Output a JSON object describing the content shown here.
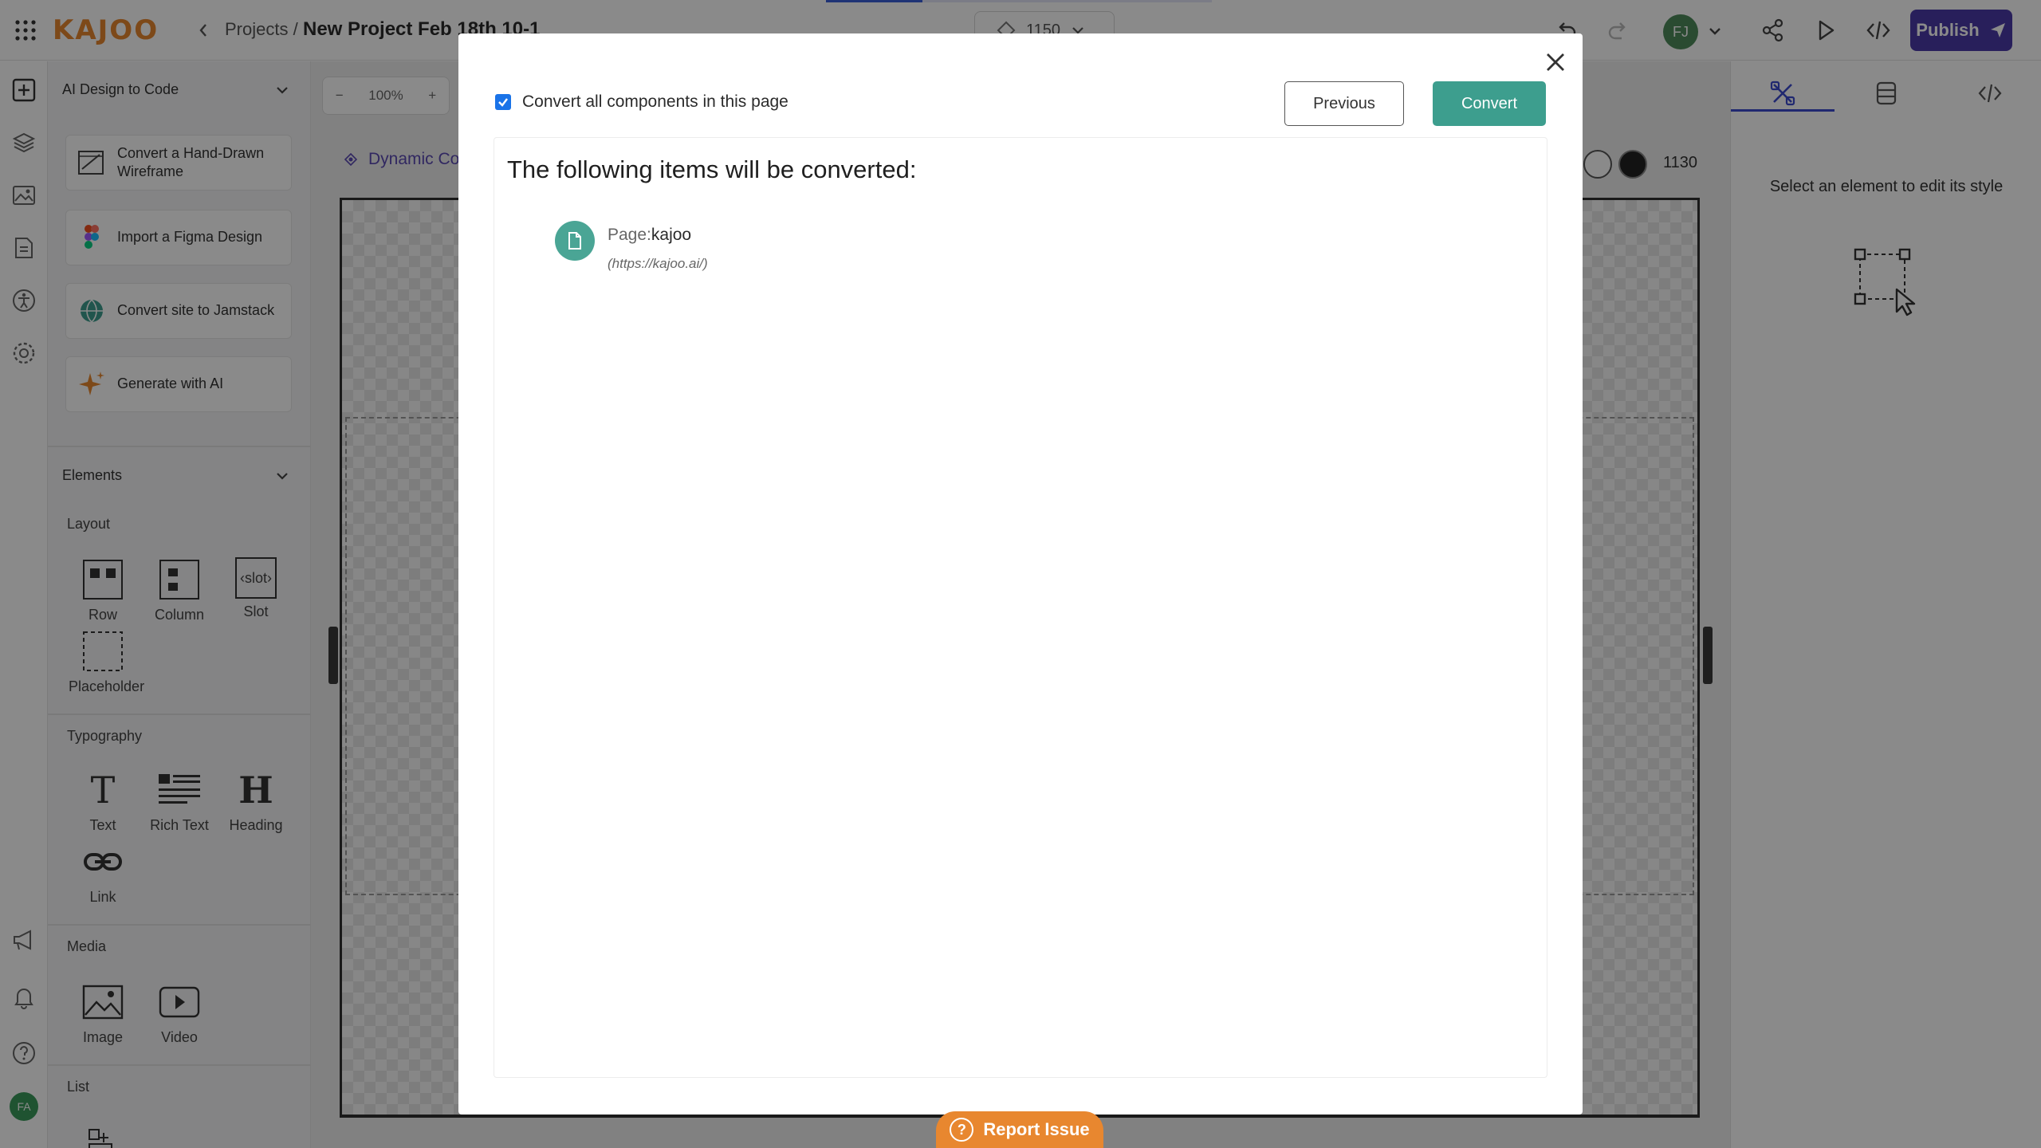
{
  "topbar": {
    "logo": "KAJOO",
    "breadcrumb_projects": "Projects /",
    "project_title": "New Project Feb 18th 10-1",
    "breakpoint_value": "1150",
    "avatar_initials": "FJ",
    "publish_label": "Publish",
    "loading_progress": 0.25
  },
  "left_panel": {
    "ai_section": {
      "title": "AI Design to Code",
      "actions": [
        {
          "label": "Convert a Hand-Drawn Wireframe",
          "icon": "wireframe-icon"
        },
        {
          "label": "Import a Figma Design",
          "icon": "figma-icon"
        },
        {
          "label": "Convert site to Jamstack",
          "icon": "globe-icon"
        },
        {
          "label": "Generate with AI",
          "icon": "sparkle-icon"
        }
      ]
    },
    "elements_section": {
      "title": "Elements",
      "layout_label": "Layout",
      "layout_items": [
        "Row",
        "Column",
        "Slot",
        "Placeholder"
      ],
      "slot_glyph": "‹slot›",
      "typography_label": "Typography",
      "typography_items": [
        "Text",
        "Rich Text",
        "Heading",
        "Link"
      ],
      "text_glyph": "T",
      "heading_glyph": "H",
      "media_label": "Media",
      "media_items": [
        "Image",
        "Video"
      ],
      "list_label": "List"
    },
    "user_avatar": "FA"
  },
  "canvas": {
    "zoom_value": "100%",
    "zoom_minus": "−",
    "zoom_plus": "+",
    "tab_label": "Dynamic Co",
    "breakpoint_width": "1130"
  },
  "right_panel": {
    "hint": "Select an element to edit its style"
  },
  "modal": {
    "checkbox_label": "Convert all components in this page",
    "checkbox_checked": true,
    "previous_label": "Previous",
    "convert_label": "Convert",
    "heading": "The following items will be converted:",
    "items": [
      {
        "type_label": "Page:",
        "name": "kajoo",
        "url": "(https://kajoo.ai/)"
      }
    ]
  },
  "report_issue": {
    "label": "Report Issue",
    "icon_glyph": "?"
  },
  "colors": {
    "accent_teal": "#3d9e8e",
    "publish_purple": "#4a3aa8",
    "brand_orange": "#e8872f",
    "checkbox_blue": "#1a73e8"
  }
}
